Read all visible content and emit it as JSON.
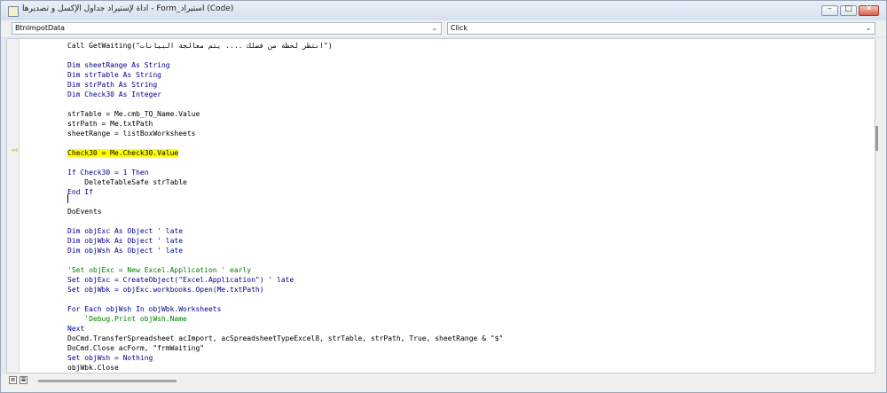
{
  "window": {
    "title": "اداة لإستيراد جداول الإكسل و تصديرها - Form_استيراد (Code)",
    "minimize": "–",
    "maximize": "□",
    "close": "✕"
  },
  "combos": {
    "object": "BtnImpotData",
    "procedure": "Click"
  },
  "code": [
    {
      "t": "Call GetWaiting(\"انتظر لحظة من فضلك .... يتم معالجة البيانات\")",
      "c": "plain"
    },
    {
      "t": "",
      "c": "plain"
    },
    {
      "t": "Dim sheetRange As String",
      "c": "kw"
    },
    {
      "t": "Dim strTable As String",
      "c": "kw"
    },
    {
      "t": "Dim strPath As String",
      "c": "kw"
    },
    {
      "t": "Dim Check30 As Integer",
      "c": "kw"
    },
    {
      "t": "",
      "c": "plain"
    },
    {
      "t": "strTable = Me.cmb_TQ_Name.Value",
      "c": "plain"
    },
    {
      "t": "strPath = Me.txtPath",
      "c": "plain"
    },
    {
      "t": "sheetRange = listBoxWorksheets",
      "c": "plain"
    },
    {
      "t": "",
      "c": "plain"
    },
    {
      "t": "Check30 = Me.Check30.Value",
      "c": "hl"
    },
    {
      "t": "",
      "c": "plain"
    },
    {
      "t": "If Check30 = 1 Then",
      "c": "kw"
    },
    {
      "t": "    DeleteTableSafe strTable",
      "c": "plain"
    },
    {
      "t": "End If",
      "c": "kw"
    },
    {
      "t": "",
      "c": "plain"
    },
    {
      "t": "DoEvents",
      "c": "plain"
    },
    {
      "t": "",
      "c": "plain"
    },
    {
      "t": "Dim objExc As Object ' late",
      "c": "kw"
    },
    {
      "t": "Dim objWbk As Object ' late",
      "c": "kw"
    },
    {
      "t": "Dim objWsh As Object ' late",
      "c": "kw"
    },
    {
      "t": "",
      "c": "plain"
    },
    {
      "t": "'Set objExc = New Excel.Application ' early",
      "c": "cm"
    },
    {
      "t": "Set objExc = CreateObject(\"Excel.Application\") ' late",
      "c": "kw"
    },
    {
      "t": "Set objWbk = objExc.workbooks.Open(Me.txtPath)",
      "c": "kw"
    },
    {
      "t": "",
      "c": "plain"
    },
    {
      "t": "For Each objWsh In objWbk.Worksheets",
      "c": "kw"
    },
    {
      "t": "    'Debug.Print objWsh.Name",
      "c": "cm"
    },
    {
      "t": "Next",
      "c": "kw"
    },
    {
      "t": "DoCmd.TransferSpreadsheet acImport, acSpreadsheetTypeExcel8, strTable, strPath, True, sheetRange & \"$\"",
      "c": "plain"
    },
    {
      "t": "DoCmd.Close acForm, \"frmWaiting\"",
      "c": "plain"
    },
    {
      "t": "Set objWsh = Nothing",
      "c": "kw"
    },
    {
      "t": "objWbk.Close",
      "c": "plain"
    }
  ],
  "icons": [
    "execution-arrow-icon",
    "procedure-view-icon",
    "full-module-view-icon"
  ]
}
